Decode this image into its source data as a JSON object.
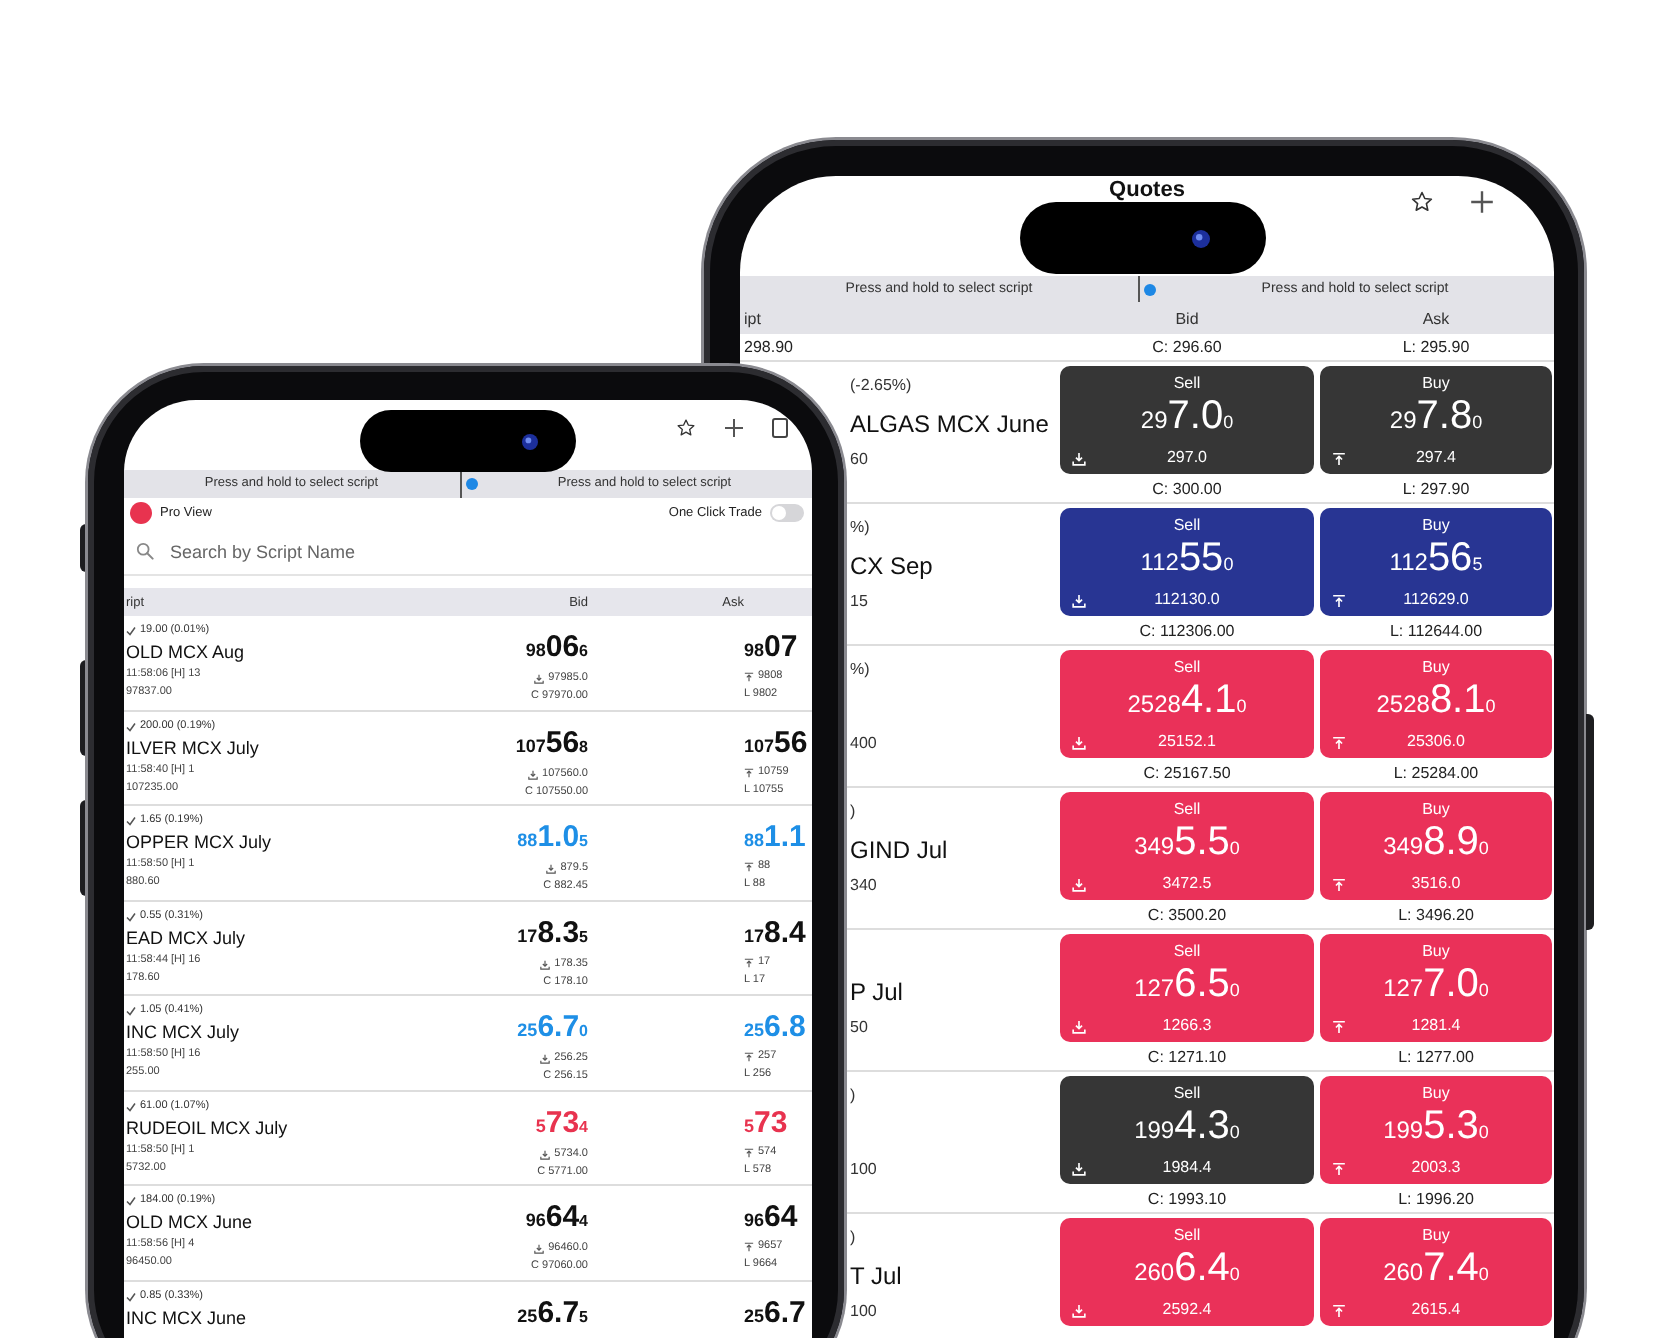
{
  "back_phone": {
    "title": "Quotes",
    "hints": [
      "Press and hold to select script",
      "Press and hold to select script"
    ],
    "columns": [
      "ipt",
      "Bid",
      "Ask"
    ],
    "top_row": {
      "script": "298.90",
      "bid": "C: 296.60",
      "ask": "L: 295.90"
    },
    "rows": [
      {
        "change": "(-2.65%)",
        "name": "ALGAS MCX June",
        "detail": "60",
        "sell": {
          "label": "Sell",
          "pre": "29",
          "main": "7.0",
          "post": "0",
          "sub": "297.0",
          "color": "#363636"
        },
        "buy": {
          "label": "Buy",
          "pre": "29",
          "main": "7.8",
          "post": "0",
          "sub": "297.4",
          "color": "#363636"
        },
        "close": "C: 300.00",
        "last": "L: 297.90"
      },
      {
        "change": "%)",
        "name": "CX Sep",
        "detail": "15",
        "sell": {
          "label": "Sell",
          "pre": "112",
          "main": "55",
          "post": "0",
          "sub": "112130.0",
          "color": "#283593"
        },
        "buy": {
          "label": "Buy",
          "pre": "112",
          "main": "56",
          "post": "5",
          "sub": "112629.0",
          "color": "#283593"
        },
        "close": "C: 112306.00",
        "last": "L: 112644.00"
      },
      {
        "change": "%)",
        "detail": "400",
        "sell": {
          "label": "Sell",
          "pre": "2528",
          "main": "4.1",
          "post": "0",
          "sub": "25152.1",
          "color": "#ea3159"
        },
        "buy": {
          "label": "Buy",
          "pre": "2528",
          "main": "8.1",
          "post": "0",
          "sub": "25306.0",
          "color": "#ea3159"
        },
        "close": "C: 25167.50",
        "last": "L: 25284.00"
      },
      {
        "change": ")",
        "name": "GIND Jul",
        "detail": "340",
        "sell": {
          "label": "Sell",
          "pre": "349",
          "main": "5.5",
          "post": "0",
          "sub": "3472.5",
          "color": "#ea3159"
        },
        "buy": {
          "label": "Buy",
          "pre": "349",
          "main": "8.9",
          "post": "0",
          "sub": "3516.0",
          "color": "#ea3159"
        },
        "close": "C: 3500.20",
        "last": "L: 3496.20"
      },
      {
        "name": "P Jul",
        "detail": "50",
        "sell": {
          "label": "Sell",
          "pre": "127",
          "main": "6.5",
          "post": "0",
          "sub": "1266.3",
          "color": "#ea3159"
        },
        "buy": {
          "label": "Buy",
          "pre": "127",
          "main": "7.0",
          "post": "0",
          "sub": "1281.4",
          "color": "#ea3159"
        },
        "close": "C: 1271.10",
        "last": "L: 1277.00"
      },
      {
        "change": ")",
        "detail": "100",
        "sell": {
          "label": "Sell",
          "pre": "199",
          "main": "4.3",
          "post": "0",
          "sub": "1984.4",
          "color": "#363636"
        },
        "buy": {
          "label": "Buy",
          "pre": "199",
          "main": "5.3",
          "post": "0",
          "sub": "2003.3",
          "color": "#ea3159"
        },
        "close": "C: 1993.10",
        "last": "L: 1996.20"
      },
      {
        "change": ")",
        "name": "T Jul",
        "detail": "100",
        "sell": {
          "label": "Sell",
          "pre": "260",
          "main": "6.4",
          "post": "0",
          "sub": "2592.4",
          "color": "#ea3159"
        },
        "buy": {
          "label": "Buy",
          "pre": "260",
          "main": "7.4",
          "post": "0",
          "sub": "2615.4",
          "color": "#ea3159"
        }
      }
    ]
  },
  "front_phone": {
    "hints": [
      "Press and hold to select script",
      "Press and hold to select script"
    ],
    "pro_view": {
      "label": "Pro View",
      "on": true
    },
    "one_click": {
      "label": "One Click Trade",
      "on": false
    },
    "search": {
      "placeholder": "Search by Script Name"
    },
    "columns": [
      "ript",
      "Bid",
      "Ask"
    ],
    "rows": [
      {
        "change": "19.00 (0.01%)",
        "name": "OLD MCX Aug",
        "time": "11:58:06 [H] 13",
        "low": "97837.00",
        "bid": {
          "pre": "98",
          "main": "06",
          "post": "6",
          "color": "#111111",
          "high": "97985.0",
          "close": "C 97970.00"
        },
        "ask": {
          "pre": "98",
          "main": "07",
          "color": "#111111",
          "high": "9808",
          "last": "L 9802"
        }
      },
      {
        "change": "200.00 (0.19%)",
        "name": "ILVER MCX July",
        "time": "11:58:40 [H] 1",
        "low": "107235.00",
        "bid": {
          "pre": "107",
          "main": "56",
          "post": "8",
          "color": "#111111",
          "high": "107560.0",
          "close": "C 107550.00"
        },
        "ask": {
          "pre": "107",
          "main": "56",
          "color": "#111111",
          "high": "10759",
          "last": "L 10755"
        }
      },
      {
        "change": "1.65 (0.19%)",
        "name": "OPPER MCX July",
        "time": "11:58:50 [H] 1",
        "low": "880.60",
        "bid": {
          "pre": "88",
          "main": "1.0",
          "post": "5",
          "color": "#1e8fe6",
          "high": "879.5",
          "close": "C 882.45"
        },
        "ask": {
          "pre": "88",
          "main": "1.1",
          "color": "#1e8fe6",
          "high": "88",
          "last": "L 88"
        }
      },
      {
        "change": "0.55 (0.31%)",
        "name": "EAD MCX July",
        "time": "11:58:44 [H] 16",
        "low": "178.60",
        "bid": {
          "pre": "17",
          "main": "8.3",
          "post": "5",
          "color": "#111111",
          "high": "178.35",
          "close": "C 178.10"
        },
        "ask": {
          "pre": "17",
          "main": "8.4",
          "color": "#111111",
          "high": "17",
          "last": "L 17"
        }
      },
      {
        "change": "1.05 (0.41%)",
        "name": "INC MCX July",
        "time": "11:58:50 [H] 16",
        "low": "255.00",
        "bid": {
          "pre": "25",
          "main": "6.7",
          "post": "0",
          "color": "#1e8fe6",
          "high": "256.25",
          "close": "C 256.15"
        },
        "ask": {
          "pre": "25",
          "main": "6.8",
          "color": "#1e8fe6",
          "high": "257",
          "last": "L 256"
        }
      },
      {
        "change": "61.00 (1.07%)",
        "name": "RUDEOIL MCX July",
        "time": "11:58:50 [H] 1",
        "low": "5732.00",
        "bid": {
          "pre": "5",
          "main": "73",
          "post": "4",
          "color": "#e8334f",
          "high": "5734.0",
          "close": "C 5771.00"
        },
        "ask": {
          "pre": "5",
          "main": "73",
          "color": "#e8334f",
          "high": "574",
          "last": "L 578"
        }
      },
      {
        "change": "184.00 (0.19%)",
        "name": "OLD MCX June",
        "time": "11:58:56 [H] 4",
        "low": "96450.00",
        "bid": {
          "pre": "96",
          "main": "64",
          "post": "4",
          "color": "#111111",
          "high": "96460.0",
          "close": "C 97060.00"
        },
        "ask": {
          "pre": "96",
          "main": "64",
          "color": "#111111",
          "high": "9657",
          "last": "L 9664"
        }
      },
      {
        "change": "0.85 (0.33%)",
        "name": "INC MCX June",
        "bid": {
          "pre": "25",
          "main": "6.7",
          "post": "5",
          "color": "#111111"
        },
        "ask": {
          "pre": "25",
          "main": "6.7",
          "color": "#111111"
        }
      }
    ]
  }
}
